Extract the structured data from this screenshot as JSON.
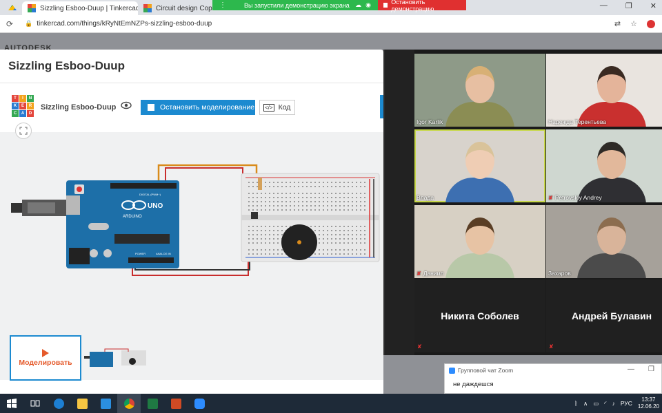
{
  "browser": {
    "tabs": [
      {
        "label": "",
        "icon": "google-drive-icon"
      },
      {
        "label": "Sizzling Esboo-Duup | Tinkercad",
        "icon": "tinkercad-icon"
      },
      {
        "label": "Circuit design Copy of",
        "icon": "tinkercad-icon"
      }
    ],
    "close_glyph": "×",
    "url": "tinkercad.com/things/kRyNtEmNZPs-sizzling-esboo-duup",
    "window_controls": [
      "—",
      "❐",
      "✕"
    ]
  },
  "screen_share": {
    "message": "Вы запустили демонстрацию экрана",
    "stop_label": "Остановить демонстрацию"
  },
  "page": {
    "brand": "AUTODESK"
  },
  "modal": {
    "title": "Sizzling Esboo-Duup",
    "logo_letters": [
      "T",
      "I",
      "N",
      "K",
      "E",
      "R",
      "C",
      "A",
      "D"
    ],
    "sim_name": "Sizzling Esboo-Duup",
    "stop_sim_label": "Остановить моделирование",
    "code_label": "Код",
    "code_icon_text": "</>",
    "simulate_label": "Моделировать",
    "board": {
      "brand": "ARDUINO",
      "model": "UNO",
      "digital": "DIGITAL (PWM~)",
      "power": "POWER",
      "analog": "ANALOG IN"
    }
  },
  "zoom": {
    "participants": [
      {
        "name": "Igor Karlik",
        "muted": false,
        "video": true,
        "bg": "#8e9a88",
        "skin": "#e7bfa2",
        "hair": "#d8b075",
        "shirt": "#8b8d54"
      },
      {
        "name": "Надежда Терентьева",
        "muted": false,
        "video": true,
        "bg": "#e9e4df",
        "skin": "#e4b49a",
        "hair": "#3a2a22",
        "shirt": "#c9302f"
      },
      {
        "name": "Влада",
        "muted": false,
        "video": true,
        "active": true,
        "bg": "#d8d3cc",
        "skin": "#efcdb4",
        "hair": "#d9c39a",
        "shirt": "#3d6fb1"
      },
      {
        "name": "Petrovskiy Andrey",
        "muted": true,
        "video": true,
        "bg": "#cfd7d0",
        "skin": "#e2b89b",
        "hair": "#2e2a26",
        "shirt": "#2f2f33"
      },
      {
        "name": "Даниил",
        "muted": true,
        "video": true,
        "bg": "#d7d0c4",
        "skin": "#e7c3a4",
        "hair": "#5a3e25",
        "shirt": "#b8c8a8"
      },
      {
        "name": "Захаров",
        "muted": false,
        "video": true,
        "bg": "#a6a19a",
        "skin": "#d9b49a",
        "hair": "#8c6d4f",
        "shirt": "#4b4b4b"
      },
      {
        "name": "",
        "big_name": "Никита Соболев",
        "muted": true,
        "video": false
      },
      {
        "name": "",
        "big_name": "Андрей Булавин",
        "muted": true,
        "video": false
      }
    ],
    "mic_muted_glyph": "✘"
  },
  "chat": {
    "title": "Групповой чат Zoom",
    "message": "не даждешся",
    "controls": [
      "—",
      "❐"
    ]
  },
  "taskbar": {
    "icons": [
      "windows-start-icon",
      "task-view-icon",
      "edge-icon",
      "file-explorer-icon",
      "vscode-icon",
      "chrome-icon",
      "excel-icon",
      "powerpoint-icon",
      "zoom-icon"
    ],
    "lang": "РУС",
    "time": "13:37",
    "date": "12.06.20",
    "tray_glyphs": [
      "ᚱ",
      "∧",
      "▭",
      "◜",
      "♪"
    ]
  },
  "colors": {
    "tinkercad_blue": "#1c8ad0",
    "simulate_orange": "#e55a2b",
    "share_green": "#2db84d",
    "share_red": "#e03030",
    "logo": [
      "#e4463c",
      "#f3a21b",
      "#35a853",
      "#2a7bd1",
      "#e4463c",
      "#f3a21b",
      "#35a853",
      "#2a7bd1",
      "#e4463c"
    ]
  }
}
